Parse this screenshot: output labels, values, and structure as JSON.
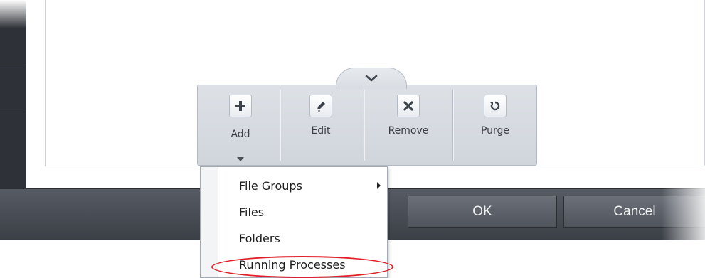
{
  "toolbar": {
    "collapse_icon": "chevron-down-icon",
    "buttons": [
      {
        "id": "add",
        "label": "Add",
        "icon": "plus-icon"
      },
      {
        "id": "edit",
        "label": "Edit",
        "icon": "pencil-icon"
      },
      {
        "id": "remove",
        "label": "Remove",
        "icon": "x-icon"
      },
      {
        "id": "purge",
        "label": "Purge",
        "icon": "refresh-icon"
      }
    ]
  },
  "add_menu": {
    "items": [
      {
        "label": "File Groups",
        "has_submenu": true
      },
      {
        "label": "Files",
        "has_submenu": false
      },
      {
        "label": "Folders",
        "has_submenu": false
      },
      {
        "label": "Running Processes",
        "has_submenu": false,
        "highlighted": true
      }
    ]
  },
  "footer": {
    "ok_label": "OK",
    "cancel_label": "Cancel"
  },
  "colors": {
    "highlight": "#e01e26",
    "footer_bar": "#3b3f46",
    "toolbar_bg": "#d5d9df"
  }
}
